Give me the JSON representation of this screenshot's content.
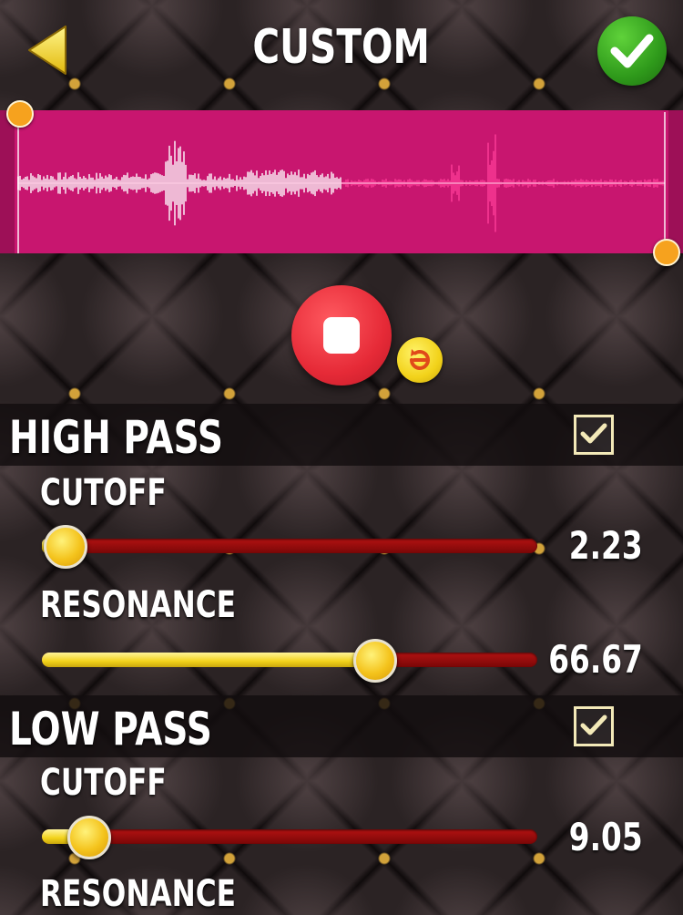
{
  "header": {
    "title": "CUSTOM"
  },
  "colors": {
    "waveform": "#c8166f",
    "accent_yellow": "#f2d21a",
    "confirm_green": "#2f9a1b",
    "record_red": "#e62a37"
  },
  "icons": {
    "back": "back-arrow-icon",
    "confirm": "check-icon",
    "record": "stop-icon",
    "loop": "loop-icon"
  },
  "high_pass": {
    "title": "HIGH PASS",
    "enabled": true,
    "cutoff": {
      "label": "CUTOFF",
      "value": "2.23",
      "position": 0.02
    },
    "resonance": {
      "label": "RESONANCE",
      "value": "66.67",
      "position": 0.667
    }
  },
  "low_pass": {
    "title": "LOW PASS",
    "enabled": true,
    "cutoff": {
      "label": "CUTOFF",
      "value": "9.05",
      "position": 0.09
    },
    "resonance": {
      "label": "RESONANCE"
    }
  }
}
